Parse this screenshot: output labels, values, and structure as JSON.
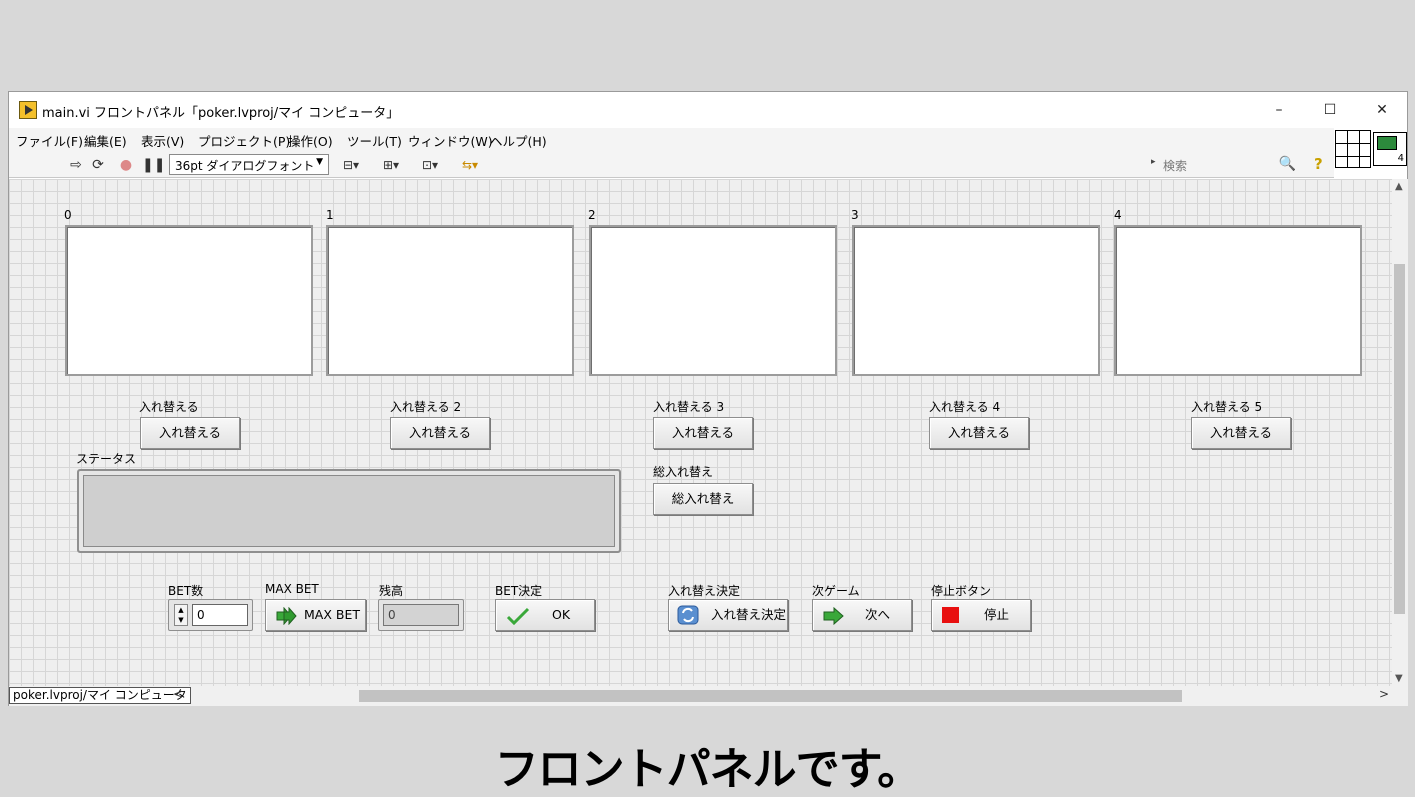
{
  "window": {
    "title": "main.vi フロントパネル「poker.lvproj/マイ コンピュータ」",
    "minimize": "–",
    "maximize": "☐",
    "close": "✕"
  },
  "menu": [
    "ファイル(F)",
    "編集(E)",
    "表示(V)",
    "プロジェクト(P)",
    "操作(O)",
    "ツール(T)",
    "ウィンドウ(W)",
    "ヘルプ(H)"
  ],
  "toolbar": {
    "font": "36pt ダイアログフォント",
    "search_placeholder": "検索"
  },
  "vi_icon_number": "4",
  "cards": [
    "0",
    "1",
    "2",
    "3",
    "4"
  ],
  "swap_buttons": [
    {
      "label": "入れ替える",
      "text": "入れ替える"
    },
    {
      "label": "入れ替える 2",
      "text": "入れ替える"
    },
    {
      "label": "入れ替える 3",
      "text": "入れ替える"
    },
    {
      "label": "入れ替える 4",
      "text": "入れ替える"
    },
    {
      "label": "入れ替える 5",
      "text": "入れ替える"
    }
  ],
  "status": {
    "label": "ステータス",
    "value": ""
  },
  "swap_all": {
    "label": "総入れ替え",
    "text": "総入れ替え"
  },
  "bet": {
    "label": "BET数",
    "value": "0"
  },
  "max_bet": {
    "label": "MAX BET",
    "text": "MAX BET"
  },
  "balance": {
    "label": "残高",
    "value": "0"
  },
  "bet_confirm": {
    "label": "BET決定",
    "text": "OK"
  },
  "swap_confirm": {
    "label": "入れ替え決定",
    "text": "入れ替え決定"
  },
  "next_game": {
    "label": "次ゲーム",
    "text": "次へ"
  },
  "stop": {
    "label": "停止ボタン",
    "text": "停止"
  },
  "status_bar": {
    "context": "poker.lvproj/マイ コンピュータ"
  },
  "caption": "フロントパネルです。",
  "colors": {
    "stop_red": "#e81010",
    "arrow_green": "#3aa83a",
    "canvas_grid": "#efefef"
  }
}
